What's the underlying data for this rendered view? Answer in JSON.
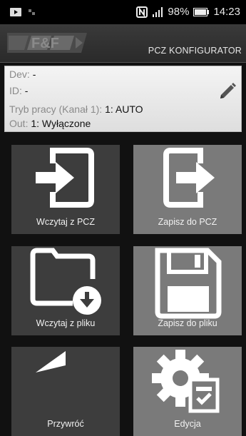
{
  "status_bar": {
    "battery": "98%",
    "time": "14:23"
  },
  "header": {
    "logo_text": "F&F",
    "title": "PCZ KONFIGURATOR"
  },
  "info": {
    "dev_label": "Dev:",
    "dev_value": "-",
    "id_label": "ID:",
    "id_value": "-",
    "mode_label": "Tryb pracy (Kanał 1):",
    "mode_value": "1: AUTO",
    "out_label": "Out:",
    "out_value": "1: Wyłączone"
  },
  "actions": [
    {
      "label": "Wczytaj z PCZ",
      "icon": "import-icon"
    },
    {
      "label": "Zapisz do PCZ",
      "icon": "export-icon"
    },
    {
      "label": "Wczytaj z pliku",
      "icon": "folder-download-icon"
    },
    {
      "label": "Zapisz do pliku",
      "icon": "save-icon"
    },
    {
      "label": "Przywróć",
      "icon": "undo-icon"
    },
    {
      "label": "Edycja",
      "icon": "gear-checklist-icon"
    }
  ],
  "colors": {
    "tile_dark": "#3d3d3d",
    "tile_light": "#7a7a7a",
    "background": "#111111"
  }
}
